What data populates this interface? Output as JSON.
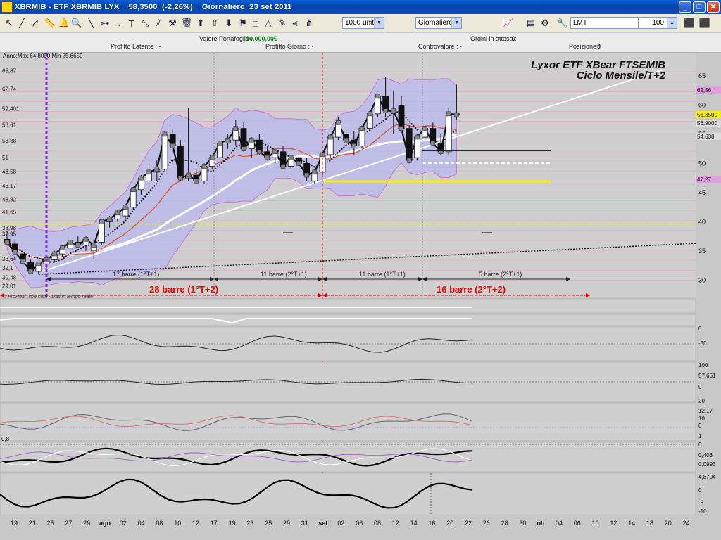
{
  "window": {
    "title": "XBRMIB - ETF XBRMIB LYX    58,3500  (-2,26%)    Giornaliero  23 set 2011",
    "btn_min": "_",
    "btn_max": "□",
    "btn_close": "✕"
  },
  "toolbar": {
    "quantity": "1000 unità",
    "period": "Giornaliero",
    "order_type": "LMT",
    "order_qty": "100"
  },
  "infobar": {
    "portfolio_label": "Valore Portafoglio :",
    "portfolio_value": "10.000,00€",
    "latent_label": "Profitto Latente : -",
    "day_profit_label": "Profitto Giorno : -",
    "counter_label": "Controvalore : -",
    "orders_label": "Ordini in attesa :",
    "orders_value": "0",
    "position_label": "Posizione :",
    "position_value": "0"
  },
  "chart_data": {
    "type": "candlestick",
    "title": "Lyxor ETF XBear FTSEMIB",
    "subtitle": "Ciclo Mensile/T+2",
    "header_info": "Anno:Max 64,8000 Min 25,6650",
    "source_note": "© ProRealTime.com - Dati in tempo reale",
    "y_ticks_left": [
      "65,87",
      "62,74",
      "59,401",
      "56,61",
      "53,88",
      "51",
      "48,58",
      "46,17",
      "43,82",
      "41,65",
      "38,98",
      "37,95",
      "33,64",
      "32,1",
      "30,48",
      "29,01"
    ],
    "y_ticks_right": [
      "65",
      "60",
      "55",
      "50",
      "45",
      "40",
      "35",
      "30"
    ],
    "ylim": [
      28,
      68
    ],
    "price_labels": {
      "last": "58,3500",
      "upper_band": "56,9000",
      "level2": "54,638",
      "level3": "47,27",
      "level4": "62,56"
    },
    "x_ticks": [
      "19",
      "21",
      "25",
      "27",
      "29",
      "ago",
      "02",
      "04",
      "08",
      "10",
      "12",
      "17",
      "19",
      "23",
      "25",
      "29",
      "31",
      "set",
      "02",
      "06",
      "08",
      "12",
      "14",
      "16",
      "20",
      "22",
      "26",
      "28",
      "30",
      "ott",
      "04",
      "06",
      "10",
      "12",
      "14",
      "18",
      "20",
      "24"
    ],
    "candles": [
      {
        "o": 37.0,
        "h": 38.5,
        "l": 36.0,
        "c": 36.5
      },
      {
        "o": 36.2,
        "h": 37.0,
        "l": 34.5,
        "c": 34.8
      },
      {
        "o": 34.5,
        "h": 35.2,
        "l": 33.0,
        "c": 33.2
      },
      {
        "o": 33.0,
        "h": 33.5,
        "l": 31.0,
        "c": 31.5
      },
      {
        "o": 31.5,
        "h": 33.0,
        "l": 31.0,
        "c": 32.8
      },
      {
        "o": 32.8,
        "h": 34.0,
        "l": 32.0,
        "c": 33.5
      },
      {
        "o": 33.5,
        "h": 35.0,
        "l": 33.0,
        "c": 34.5
      },
      {
        "o": 34.5,
        "h": 36.0,
        "l": 34.0,
        "c": 35.5
      },
      {
        "o": 35.5,
        "h": 37.0,
        "l": 35.0,
        "c": 36.5
      },
      {
        "o": 36.5,
        "h": 37.5,
        "l": 36.0,
        "c": 36.0
      },
      {
        "o": 36.0,
        "h": 37.5,
        "l": 35.0,
        "c": 37.0
      },
      {
        "o": 35.0,
        "h": 37.0,
        "l": 33.5,
        "c": 36.0
      },
      {
        "o": 36.5,
        "h": 40.5,
        "l": 36.0,
        "c": 40.0
      },
      {
        "o": 40.0,
        "h": 41.0,
        "l": 39.0,
        "c": 40.5
      },
      {
        "o": 40.5,
        "h": 42.0,
        "l": 40.0,
        "c": 41.5
      },
      {
        "o": 41.0,
        "h": 43.0,
        "l": 40.5,
        "c": 42.5
      },
      {
        "o": 42.5,
        "h": 46.0,
        "l": 42.0,
        "c": 45.5
      },
      {
        "o": 45.5,
        "h": 48.0,
        "l": 44.5,
        "c": 47.5
      },
      {
        "o": 47.0,
        "h": 50.0,
        "l": 46.0,
        "c": 48.5
      },
      {
        "o": 48.5,
        "h": 50.5,
        "l": 47.0,
        "c": 49.0
      },
      {
        "o": 49.0,
        "h": 55.5,
        "l": 48.5,
        "c": 55.0
      },
      {
        "o": 55.0,
        "h": 56.0,
        "l": 52.0,
        "c": 53.0
      },
      {
        "o": 53.0,
        "h": 54.0,
        "l": 47.0,
        "c": 47.5
      },
      {
        "o": 47.5,
        "h": 59.5,
        "l": 47.0,
        "c": 48.0
      },
      {
        "o": 48.0,
        "h": 49.0,
        "l": 46.5,
        "c": 47.0
      },
      {
        "o": 47.0,
        "h": 50.0,
        "l": 46.5,
        "c": 49.5
      },
      {
        "o": 49.5,
        "h": 51.5,
        "l": 49.0,
        "c": 51.0
      },
      {
        "o": 51.0,
        "h": 54.0,
        "l": 50.5,
        "c": 53.5
      },
      {
        "o": 53.5,
        "h": 55.0,
        "l": 52.5,
        "c": 54.0
      },
      {
        "o": 54.0,
        "h": 57.5,
        "l": 53.0,
        "c": 56.0
      },
      {
        "o": 56.0,
        "h": 57.0,
        "l": 52.0,
        "c": 52.5
      },
      {
        "o": 52.5,
        "h": 54.5,
        "l": 51.0,
        "c": 54.0
      },
      {
        "o": 54.0,
        "h": 55.0,
        "l": 51.5,
        "c": 52.0
      },
      {
        "o": 52.0,
        "h": 53.0,
        "l": 50.5,
        "c": 51.0
      },
      {
        "o": 51.0,
        "h": 52.5,
        "l": 50.0,
        "c": 52.0
      },
      {
        "o": 52.0,
        "h": 53.0,
        "l": 49.0,
        "c": 49.5
      },
      {
        "o": 49.5,
        "h": 51.5,
        "l": 49.0,
        "c": 51.0
      },
      {
        "o": 51.0,
        "h": 52.0,
        "l": 49.5,
        "c": 50.0
      },
      {
        "o": 50.0,
        "h": 51.0,
        "l": 47.0,
        "c": 48.0
      },
      {
        "o": 47.0,
        "h": 49.0,
        "l": 46.5,
        "c": 48.5
      },
      {
        "o": 48.5,
        "h": 52.0,
        "l": 48.0,
        "c": 51.5
      },
      {
        "o": 51.5,
        "h": 55.0,
        "l": 51.0,
        "c": 54.5
      },
      {
        "o": 54.5,
        "h": 58.0,
        "l": 54.0,
        "c": 57.0
      },
      {
        "o": 55.0,
        "h": 56.0,
        "l": 53.0,
        "c": 54.0
      },
      {
        "o": 54.0,
        "h": 55.5,
        "l": 51.5,
        "c": 53.0
      },
      {
        "o": 53.0,
        "h": 56.5,
        "l": 52.5,
        "c": 56.0
      },
      {
        "o": 56.0,
        "h": 59.0,
        "l": 55.5,
        "c": 58.5
      },
      {
        "o": 58.5,
        "h": 62.0,
        "l": 58.0,
        "c": 61.5
      },
      {
        "o": 61.5,
        "h": 64.8,
        "l": 58.0,
        "c": 59.0
      },
      {
        "o": 59.0,
        "h": 62.5,
        "l": 55.0,
        "c": 59.0
      },
      {
        "o": 60.0,
        "h": 61.5,
        "l": 55.5,
        "c": 56.0
      },
      {
        "o": 56.0,
        "h": 56.5,
        "l": 50.0,
        "c": 50.5
      },
      {
        "o": 51.0,
        "h": 55.0,
        "l": 50.5,
        "c": 54.5
      },
      {
        "o": 54.5,
        "h": 56.5,
        "l": 54.0,
        "c": 56.0
      },
      {
        "o": 56.0,
        "h": 57.0,
        "l": 53.0,
        "c": 53.5
      },
      {
        "o": 53.5,
        "h": 55.0,
        "l": 51.5,
        "c": 52.0
      },
      {
        "o": 52.0,
        "h": 59.5,
        "l": 51.5,
        "c": 58.5
      },
      {
        "o": 58.5,
        "h": 63.5,
        "l": 57.5,
        "c": 58.35
      }
    ],
    "annotations": [
      {
        "text": "17 barre (1°T+1)"
      },
      {
        "text": "28 barre (1°T+2)"
      },
      {
        "text": "11 barre (2°T+1)"
      },
      {
        "text": "11 barre (1°T+1)"
      },
      {
        "text": "16 barre (2°T+2)"
      },
      {
        "text": "5 barre (2°T+1)"
      }
    ],
    "indicators": [
      {
        "name": "ind1",
        "ticks": []
      },
      {
        "name": "ind2",
        "ticks": [
          "0",
          "-50"
        ]
      },
      {
        "name": "ind3",
        "ticks": [
          "100",
          "57,661",
          "0"
        ],
        "last": "57,661"
      },
      {
        "name": "ind4",
        "ticks": [
          "20",
          "12,17",
          "10",
          "0"
        ],
        "last": "12,17"
      },
      {
        "name": "ind5",
        "ticks": [
          "1",
          "0,403",
          "0,0993",
          "0"
        ],
        "top_label": "0,8"
      },
      {
        "name": "ind6",
        "ticks": [
          "4,8704",
          "0",
          "-5",
          "-10"
        ]
      }
    ]
  }
}
